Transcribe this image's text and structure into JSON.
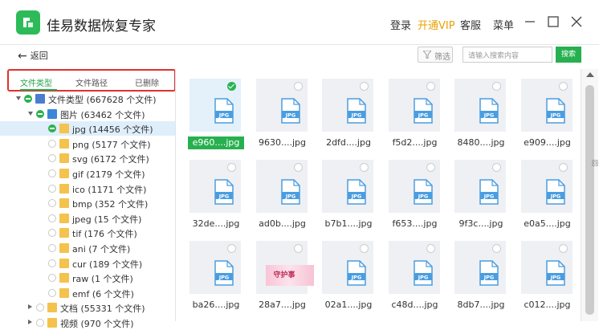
{
  "app": {
    "title": "佳易数据恢复专家"
  },
  "header": {
    "login": "登录",
    "vip": "开通VIP",
    "service": "客服",
    "menu": "菜单"
  },
  "toolbar": {
    "back": "返回",
    "filter": "筛选",
    "search_placeholder": "请输入搜索内容",
    "search_button": "搜索"
  },
  "tabs": [
    {
      "label": "文件类型",
      "active": true
    },
    {
      "label": "文件路径",
      "active": false
    },
    {
      "label": "已删除",
      "active": false
    }
  ],
  "tree": [
    {
      "label": "文件类型 (667628 个文件)",
      "level": 0,
      "expanded": true,
      "check": "partial",
      "icon": "computer-icon"
    },
    {
      "label": "图片 (63462 个文件)",
      "level": 1,
      "expanded": true,
      "check": "partial",
      "icon": "image-folder-icon"
    },
    {
      "label": "jpg (14456 个文件)",
      "level": 2,
      "check": "partial",
      "icon": "folder-icon",
      "selected": true
    },
    {
      "label": "png (5177 个文件)",
      "level": 2,
      "check": "none",
      "icon": "folder-icon"
    },
    {
      "label": "svg (6172 个文件)",
      "level": 2,
      "check": "none",
      "icon": "folder-icon"
    },
    {
      "label": "gif (2179 个文件)",
      "level": 2,
      "check": "none",
      "icon": "folder-icon"
    },
    {
      "label": "ico (1171 个文件)",
      "level": 2,
      "check": "none",
      "icon": "folder-icon"
    },
    {
      "label": "bmp (352 个文件)",
      "level": 2,
      "check": "none",
      "icon": "folder-icon"
    },
    {
      "label": "jpeg (15 个文件)",
      "level": 2,
      "check": "none",
      "icon": "folder-icon"
    },
    {
      "label": "tif (176 个文件)",
      "level": 2,
      "check": "none",
      "icon": "folder-icon"
    },
    {
      "label": "ani (7 个文件)",
      "level": 2,
      "check": "none",
      "icon": "folder-icon"
    },
    {
      "label": "cur (189 个文件)",
      "level": 2,
      "check": "none",
      "icon": "folder-icon"
    },
    {
      "label": "raw (1 个文件)",
      "level": 2,
      "check": "none",
      "icon": "folder-icon"
    },
    {
      "label": "emf (6 个文件)",
      "level": 2,
      "check": "none",
      "icon": "folder-icon"
    },
    {
      "label": "文档 (55331 个文件)",
      "level": 1,
      "expanded": false,
      "check": "none",
      "icon": "folder-icon"
    },
    {
      "label": "视频 (970 个文件)",
      "level": 1,
      "expanded": false,
      "check": "none",
      "icon": "folder-icon"
    }
  ],
  "files": [
    {
      "name": "e960....jpg",
      "checked": true,
      "selected": true
    },
    {
      "name": "9630....jpg"
    },
    {
      "name": "2dfd....jpg"
    },
    {
      "name": "f5d2....jpg"
    },
    {
      "name": "8480....jpg"
    },
    {
      "name": "e909....jpg"
    },
    {
      "name": "32de....jpg"
    },
    {
      "name": "ad0b....jpg"
    },
    {
      "name": "b7b1....jpg"
    },
    {
      "name": "f653....jpg"
    },
    {
      "name": "9f3c....jpg"
    },
    {
      "name": "e0a5....jpg"
    },
    {
      "name": "ba26....jpg"
    },
    {
      "name": "28a7....jpg",
      "photo_text": "守护事"
    },
    {
      "name": "02a1....jpg"
    },
    {
      "name": "c48d....jpg"
    },
    {
      "name": "8db7....jpg"
    },
    {
      "name": "c012....jpg"
    }
  ],
  "doc_icon_label": "JPG",
  "edge_text": "回",
  "colors": {
    "accent": "#27b04f",
    "vip": "#e8a100",
    "highlight": "#e0322e"
  }
}
